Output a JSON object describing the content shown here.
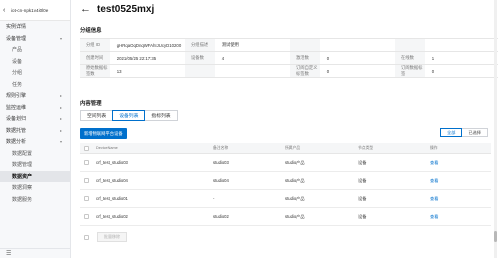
{
  "sidebar": {
    "instance": "iot-cn-npk1v4i0l0e",
    "items": [
      {
        "label": "实例详情",
        "level": 1,
        "active": false,
        "caret": ""
      },
      {
        "label": "设备管理",
        "level": 1,
        "active": false,
        "caret": "▾"
      },
      {
        "label": "产品",
        "level": 2,
        "active": false,
        "caret": ""
      },
      {
        "label": "设备",
        "level": 2,
        "active": false,
        "caret": ""
      },
      {
        "label": "分组",
        "level": 2,
        "active": false,
        "caret": ""
      },
      {
        "label": "任务",
        "level": 2,
        "active": false,
        "caret": ""
      },
      {
        "label": "规则引擎",
        "level": 1,
        "active": false,
        "caret": "▸"
      },
      {
        "label": "监控运维",
        "level": 1,
        "active": false,
        "caret": "▸"
      },
      {
        "label": "设备划归",
        "level": 1,
        "active": false,
        "caret": "▸"
      },
      {
        "label": "数据托管",
        "level": 1,
        "active": false,
        "caret": "▸"
      },
      {
        "label": "数据分析",
        "level": 1,
        "active": false,
        "caret": "▾"
      },
      {
        "label": "数据配置",
        "level": 2,
        "active": false,
        "caret": ""
      },
      {
        "label": "数据管理",
        "level": 2,
        "active": false,
        "caret": ""
      },
      {
        "label": "数据资产",
        "level": 2,
        "active": true,
        "caret": ""
      },
      {
        "label": "数据洞察",
        "level": 2,
        "active": false,
        "caret": ""
      },
      {
        "label": "数据服务",
        "level": 2,
        "active": false,
        "caret": ""
      }
    ],
    "collapse_icon": "☰"
  },
  "header": {
    "title": "test0525mxj"
  },
  "sections": {
    "info": "分组信息",
    "content": "内容管理"
  },
  "info": {
    "rows": [
      [
        "分组 ID",
        "gHRqaOqDnqWFAhIJUcyD10200",
        "分组描述",
        "测试使用",
        "",
        "",
        "",
        ""
      ],
      [
        "创建时间",
        "2021/05/25 22:17:35",
        "设备数",
        "4",
        "激活数",
        "0",
        "在线数",
        "1"
      ],
      [
        "原始数据标签数",
        "13",
        "",
        "",
        "订阅自定义标签数",
        "0",
        "订阅数据标签",
        "0"
      ]
    ]
  },
  "tabs": [
    "空间列表",
    "设备列表",
    "指标列表"
  ],
  "active_tab": 1,
  "actions": {
    "add_button": "新增物联网平台设备",
    "filter_all": "全部",
    "filter_selected": "已选择"
  },
  "table": {
    "headers": [
      "DeviceName",
      "备注名称",
      "所属产品",
      "节点类型",
      "操作"
    ],
    "rows": [
      {
        "name": "crf_test_studio03",
        "note": "studio03",
        "product": "studio产品",
        "type": "设备",
        "op": "查看"
      },
      {
        "name": "crf_test_studio04",
        "note": "studio04",
        "product": "studio产品",
        "type": "设备",
        "op": "查看"
      },
      {
        "name": "crf_test_studio01",
        "note": "-",
        "product": "studio产品",
        "type": "设备",
        "op": "查看"
      },
      {
        "name": "crf_test_studio02",
        "note": "studio02",
        "product": "studio产品",
        "type": "设备",
        "op": "查看"
      }
    ]
  },
  "footer": {
    "batch_button": "批量移除"
  },
  "colors": {
    "accent": "#0070cc",
    "sidebar_bg": "#f7f8fa",
    "active_bg": "#e3e5e9"
  }
}
